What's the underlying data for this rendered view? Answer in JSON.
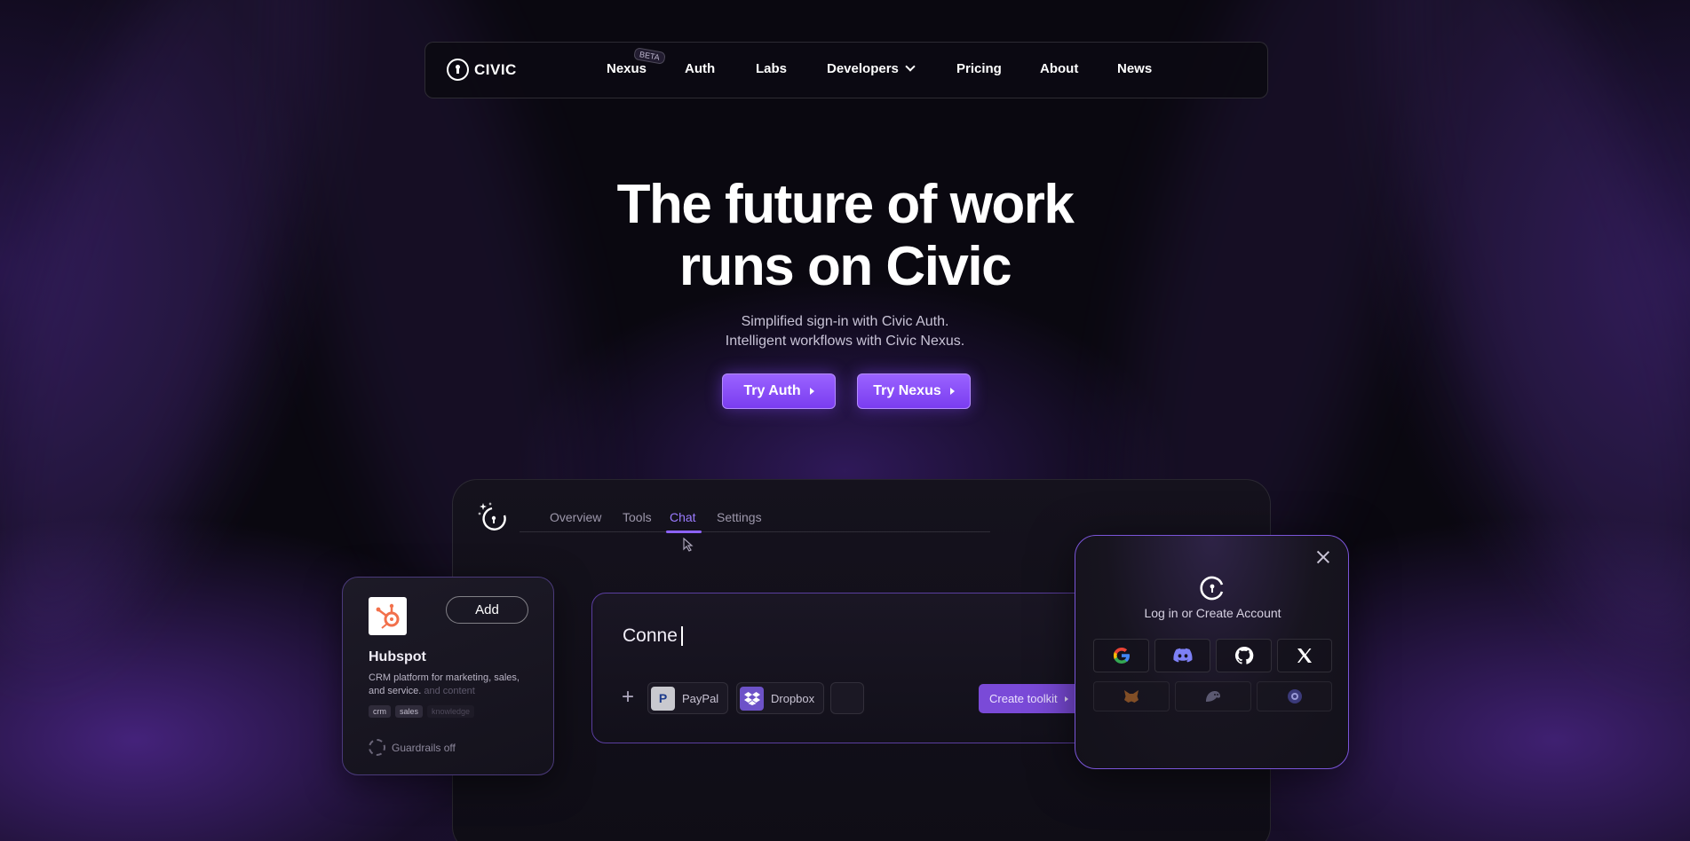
{
  "brand": {
    "name": "CIVIC"
  },
  "nav": {
    "items": [
      {
        "label": "Nexus",
        "badge": "BETA"
      },
      {
        "label": "Auth"
      },
      {
        "label": "Labs"
      },
      {
        "label": "Developers"
      },
      {
        "label": "Pricing"
      },
      {
        "label": "About"
      },
      {
        "label": "News"
      }
    ]
  },
  "hero": {
    "title_line1": "The future of work",
    "title_line2": "runs on Civic",
    "subtitle_line1": "Simplified sign-in with Civic Auth.",
    "subtitle_line2": "Intelligent workflows with Civic Nexus.",
    "cta_auth": "Try Auth",
    "cta_nexus": "Try Nexus"
  },
  "app": {
    "tabs": [
      "Overview",
      "Tools",
      "Chat",
      "Settings"
    ],
    "active_tab": "Chat",
    "chat_input": "Conne",
    "integrations": [
      {
        "label": "PayPal",
        "icon": "paypal-icon"
      },
      {
        "label": "Dropbox",
        "icon": "dropbox-icon"
      }
    ],
    "create_toolkit": "Create toolkit"
  },
  "hubspot": {
    "add_label": "Add",
    "name": "Hubspot",
    "desc": "CRM platform for marketing, sales, and service.",
    "desc_fade": " and content",
    "tags": [
      "crm",
      "sales"
    ],
    "tag_fade": "knowledge",
    "guardrails": "Guardrails off"
  },
  "login": {
    "title": "Log in or Create Account",
    "providers": [
      "google-icon",
      "discord-icon",
      "github-icon",
      "x-icon"
    ],
    "wallets": [
      "metamask-icon",
      "phantom-icon",
      "coinbase-icon"
    ]
  },
  "colors": {
    "accent": "#8d63ff",
    "background": "#0a0810",
    "button": "#7a3df0"
  }
}
